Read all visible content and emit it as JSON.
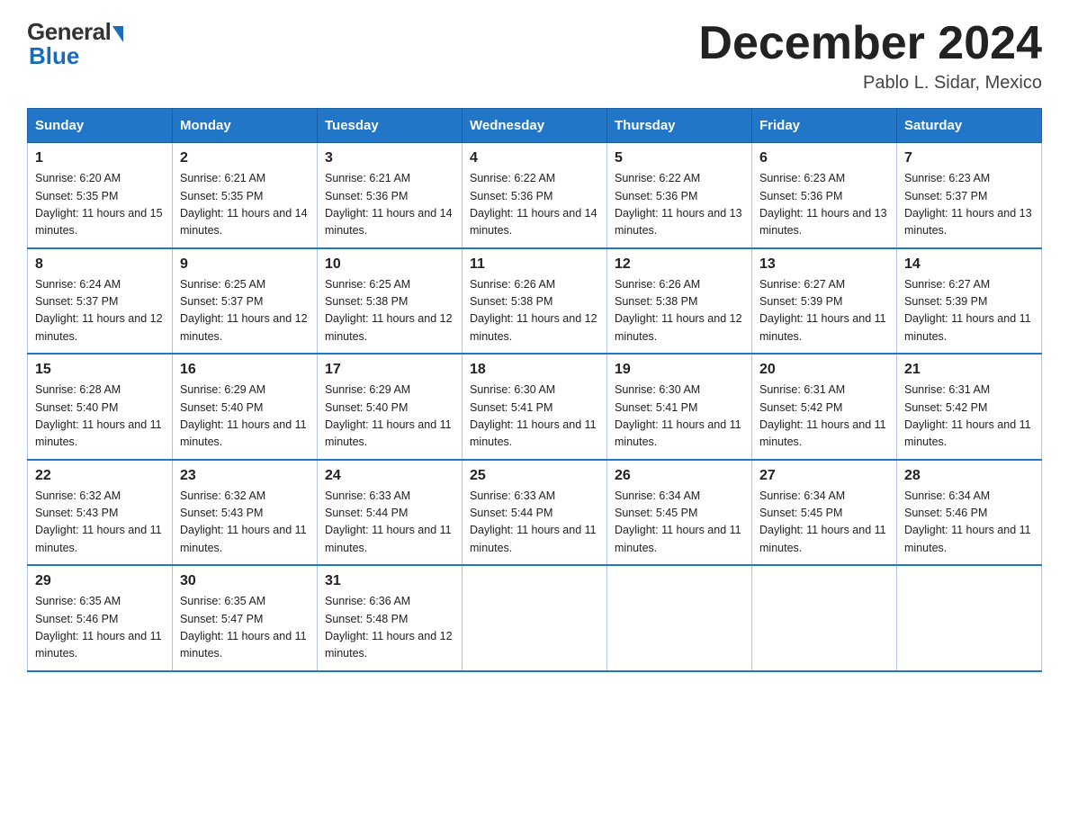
{
  "header": {
    "logo_general": "General",
    "logo_blue": "Blue",
    "month_title": "December 2024",
    "subtitle": "Pablo L. Sidar, Mexico"
  },
  "days_of_week": [
    "Sunday",
    "Monday",
    "Tuesday",
    "Wednesday",
    "Thursday",
    "Friday",
    "Saturday"
  ],
  "weeks": [
    [
      {
        "day": "1",
        "sunrise": "6:20 AM",
        "sunset": "5:35 PM",
        "daylight": "11 hours and 15 minutes."
      },
      {
        "day": "2",
        "sunrise": "6:21 AM",
        "sunset": "5:35 PM",
        "daylight": "11 hours and 14 minutes."
      },
      {
        "day": "3",
        "sunrise": "6:21 AM",
        "sunset": "5:36 PM",
        "daylight": "11 hours and 14 minutes."
      },
      {
        "day": "4",
        "sunrise": "6:22 AM",
        "sunset": "5:36 PM",
        "daylight": "11 hours and 14 minutes."
      },
      {
        "day": "5",
        "sunrise": "6:22 AM",
        "sunset": "5:36 PM",
        "daylight": "11 hours and 13 minutes."
      },
      {
        "day": "6",
        "sunrise": "6:23 AM",
        "sunset": "5:36 PM",
        "daylight": "11 hours and 13 minutes."
      },
      {
        "day": "7",
        "sunrise": "6:23 AM",
        "sunset": "5:37 PM",
        "daylight": "11 hours and 13 minutes."
      }
    ],
    [
      {
        "day": "8",
        "sunrise": "6:24 AM",
        "sunset": "5:37 PM",
        "daylight": "11 hours and 12 minutes."
      },
      {
        "day": "9",
        "sunrise": "6:25 AM",
        "sunset": "5:37 PM",
        "daylight": "11 hours and 12 minutes."
      },
      {
        "day": "10",
        "sunrise": "6:25 AM",
        "sunset": "5:38 PM",
        "daylight": "11 hours and 12 minutes."
      },
      {
        "day": "11",
        "sunrise": "6:26 AM",
        "sunset": "5:38 PM",
        "daylight": "11 hours and 12 minutes."
      },
      {
        "day": "12",
        "sunrise": "6:26 AM",
        "sunset": "5:38 PM",
        "daylight": "11 hours and 12 minutes."
      },
      {
        "day": "13",
        "sunrise": "6:27 AM",
        "sunset": "5:39 PM",
        "daylight": "11 hours and 11 minutes."
      },
      {
        "day": "14",
        "sunrise": "6:27 AM",
        "sunset": "5:39 PM",
        "daylight": "11 hours and 11 minutes."
      }
    ],
    [
      {
        "day": "15",
        "sunrise": "6:28 AM",
        "sunset": "5:40 PM",
        "daylight": "11 hours and 11 minutes."
      },
      {
        "day": "16",
        "sunrise": "6:29 AM",
        "sunset": "5:40 PM",
        "daylight": "11 hours and 11 minutes."
      },
      {
        "day": "17",
        "sunrise": "6:29 AM",
        "sunset": "5:40 PM",
        "daylight": "11 hours and 11 minutes."
      },
      {
        "day": "18",
        "sunrise": "6:30 AM",
        "sunset": "5:41 PM",
        "daylight": "11 hours and 11 minutes."
      },
      {
        "day": "19",
        "sunrise": "6:30 AM",
        "sunset": "5:41 PM",
        "daylight": "11 hours and 11 minutes."
      },
      {
        "day": "20",
        "sunrise": "6:31 AM",
        "sunset": "5:42 PM",
        "daylight": "11 hours and 11 minutes."
      },
      {
        "day": "21",
        "sunrise": "6:31 AM",
        "sunset": "5:42 PM",
        "daylight": "11 hours and 11 minutes."
      }
    ],
    [
      {
        "day": "22",
        "sunrise": "6:32 AM",
        "sunset": "5:43 PM",
        "daylight": "11 hours and 11 minutes."
      },
      {
        "day": "23",
        "sunrise": "6:32 AM",
        "sunset": "5:43 PM",
        "daylight": "11 hours and 11 minutes."
      },
      {
        "day": "24",
        "sunrise": "6:33 AM",
        "sunset": "5:44 PM",
        "daylight": "11 hours and 11 minutes."
      },
      {
        "day": "25",
        "sunrise": "6:33 AM",
        "sunset": "5:44 PM",
        "daylight": "11 hours and 11 minutes."
      },
      {
        "day": "26",
        "sunrise": "6:34 AM",
        "sunset": "5:45 PM",
        "daylight": "11 hours and 11 minutes."
      },
      {
        "day": "27",
        "sunrise": "6:34 AM",
        "sunset": "5:45 PM",
        "daylight": "11 hours and 11 minutes."
      },
      {
        "day": "28",
        "sunrise": "6:34 AM",
        "sunset": "5:46 PM",
        "daylight": "11 hours and 11 minutes."
      }
    ],
    [
      {
        "day": "29",
        "sunrise": "6:35 AM",
        "sunset": "5:46 PM",
        "daylight": "11 hours and 11 minutes."
      },
      {
        "day": "30",
        "sunrise": "6:35 AM",
        "sunset": "5:47 PM",
        "daylight": "11 hours and 11 minutes."
      },
      {
        "day": "31",
        "sunrise": "6:36 AM",
        "sunset": "5:48 PM",
        "daylight": "11 hours and 12 minutes."
      },
      null,
      null,
      null,
      null
    ]
  ]
}
